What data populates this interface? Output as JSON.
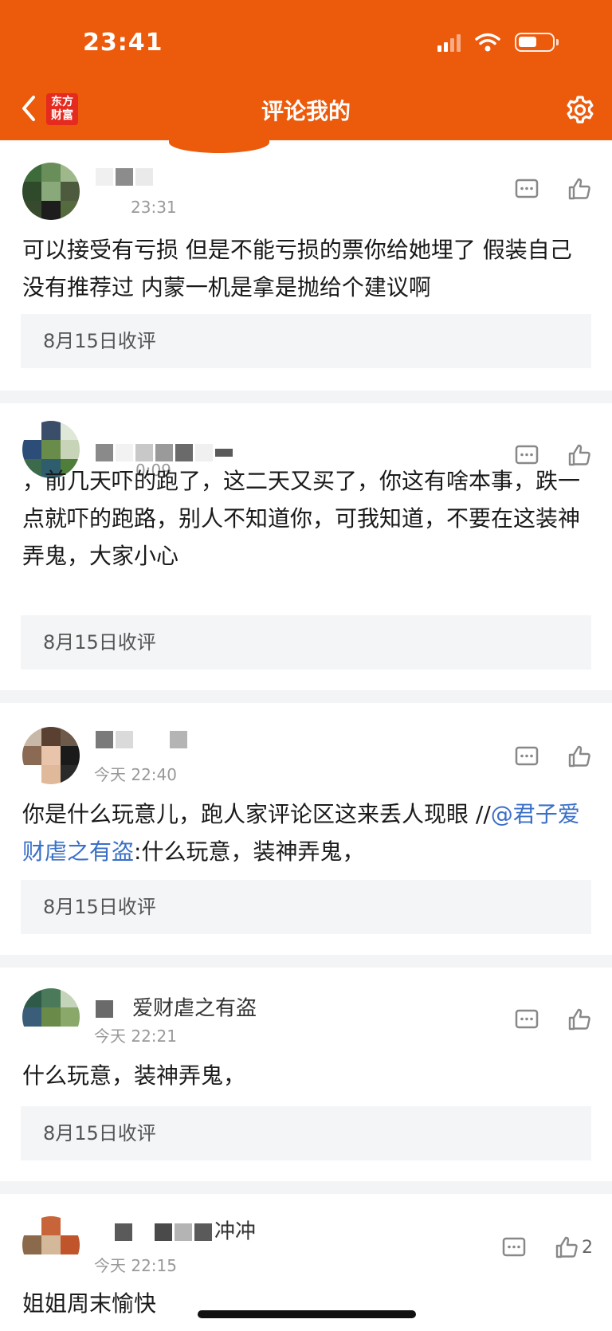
{
  "status_bar": {
    "time": "23:41"
  },
  "header": {
    "logo_line1": "东方",
    "logo_line2": "财富",
    "title": "评论我的"
  },
  "comments": [
    {
      "time": "23:31",
      "text": "可以接受有亏损 但是不能亏损的票你给她埋了 假装自己没有推荐过 内蒙一机是拿是抛给个建议啊",
      "tag": "8月15日收评"
    },
    {
      "time": "0:09",
      "text": "，前几天吓的跑了，这二天又买了，你这有啥本事，跌一点就吓的跑路，别人不知道你，可我知道，不要在这装神弄鬼，大家小心",
      "tag": "8月15日收评"
    },
    {
      "time": "今天 22:40",
      "text_before": "你是什么玩意儿，跑人家评论区这来丢人现眼 //",
      "mention": "@君子爱财虐之有盗",
      "text_after": ":什么玩意，装神弄鬼，",
      "tag": "8月15日收评"
    },
    {
      "username_visible": "爱财虐之有盗",
      "time": "今天 22:21",
      "text": "什么玩意，装神弄鬼，",
      "tag": "8月15日收评"
    },
    {
      "username_visible": "冲冲",
      "time": "今天 22:15",
      "text": "姐姐周末愉快",
      "like_count": "2"
    }
  ],
  "colors": {
    "brand_orange": "#ec5a0c",
    "mention_blue": "#3a6fc7",
    "tag_bg": "#f4f5f7"
  },
  "icons": [
    "back-chevron-icon",
    "gear-icon",
    "reply-icon",
    "thumbs-up-icon",
    "wifi-icon",
    "battery-icon",
    "signal-icon"
  ]
}
